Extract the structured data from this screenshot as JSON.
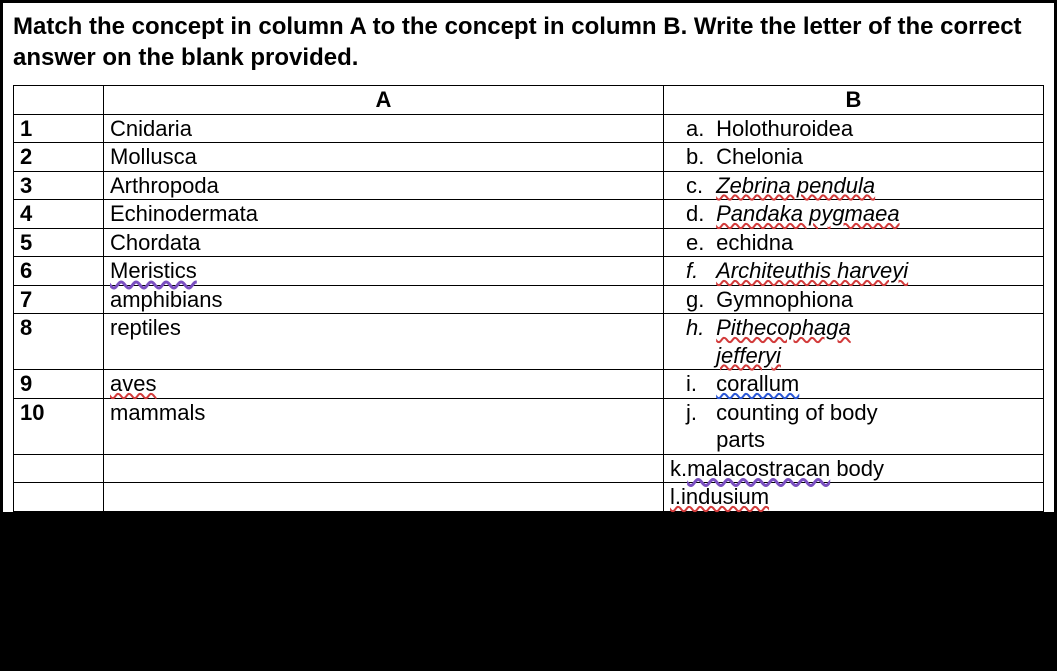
{
  "instructions": "Match the concept in column A to the concept in column B. Write the letter of the correct answer on the blank provided.",
  "headers": {
    "a": "A",
    "b": "B"
  },
  "rows": [
    {
      "num": "1",
      "a": "Cnidaria",
      "bLetter": "a.",
      "bText": "Holothuroidea"
    },
    {
      "num": "2",
      "a": "Mollusca",
      "bLetter": "b.",
      "bText": "Chelonia"
    },
    {
      "num": "3",
      "a": "Arthropoda",
      "bLetter": "c.",
      "bText": "Zebrina pendula"
    },
    {
      "num": "4",
      "a": "Echinodermata",
      "bLetter": "d.",
      "bText": "Pandaka pygmaea"
    },
    {
      "num": "5",
      "a": "Chordata",
      "bLetter": "e.",
      "bText": "echidna"
    },
    {
      "num": "6",
      "a": "Meristics",
      "bLetter": "f.",
      "bText": "Architeuthis harveyi"
    },
    {
      "num": "7",
      "a": "amphibians",
      "bLetter": "g.",
      "bText": "Gymnophiona"
    },
    {
      "num": "8",
      "a": "reptiles",
      "bLetter": "h.",
      "bText": "Pithecophaga",
      "bText2": "jefferyi"
    },
    {
      "num": "9",
      "a": "aves",
      "bLetter": "i.",
      "bText": "corallum"
    },
    {
      "num": "10",
      "a": "mammals",
      "bLetter": "j.",
      "bText": "counting of body",
      "bText2": "parts"
    },
    {
      "num": "",
      "a": "",
      "bLetter": "k.",
      "bText": "malacostracan",
      "bText3": " body"
    },
    {
      "num": "",
      "a": "",
      "bLetter": "l.",
      "bText": "indusium"
    }
  ]
}
